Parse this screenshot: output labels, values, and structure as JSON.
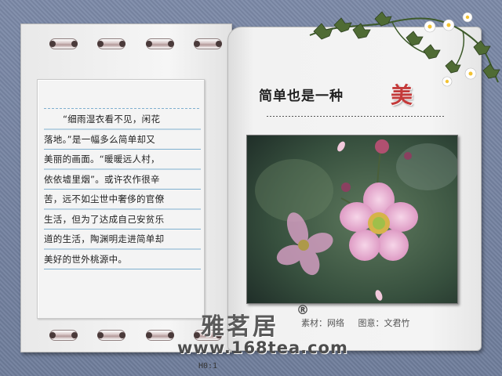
{
  "poem": {
    "lines": [
      "“细雨湿衣看不见，闲花",
      "落地。”是一幅多么简单却又",
      "美丽的画面。“暖暖远人村，",
      "依依墟里烟”。或许农作很辛",
      "苦，远不如尘世中奢侈的官僚",
      "生活，但为了达成自己安贫乐",
      "道的生活，陶渊明走进简单却",
      "美好的世外桃源中。"
    ],
    "page_number": "H0:1"
  },
  "title": {
    "main": "简单也是一种",
    "accent": "美"
  },
  "credits": {
    "material": "素材：网络",
    "design": "图意：文君竹"
  },
  "logo": {
    "text": "雅茗居",
    "reg": "®",
    "site": "www.168tea.com"
  }
}
